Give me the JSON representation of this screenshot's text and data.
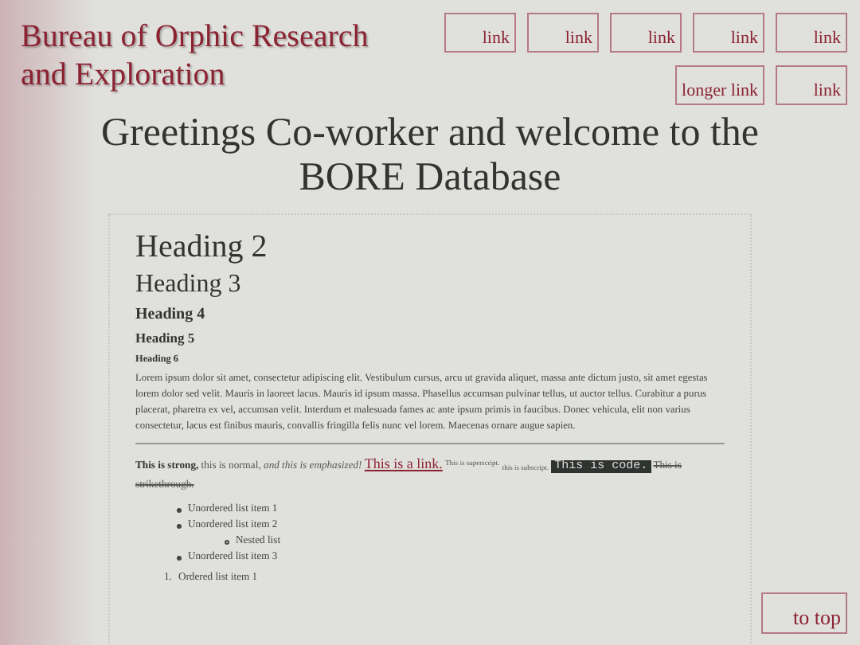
{
  "site_title": "Bureau of Orphic Research and Exploration",
  "nav_links": [
    "link",
    "link",
    "link",
    "link",
    "link",
    "longer link",
    "link"
  ],
  "greeting": "Greetings Co-worker and welcome to the BORE Database",
  "headings": [
    {
      "kind": "h2",
      "text": "Heading 2"
    },
    {
      "kind": "h3",
      "text": "Heading 3"
    },
    {
      "kind": "h4",
      "text": "Heading 4"
    },
    {
      "kind": "h5",
      "text": "Heading 5"
    },
    {
      "kind": "h6",
      "text": "Heading 6"
    }
  ],
  "paragraph": "Lorem ipsum dolor sit amet, consectetur adipiscing elit. Vestibulum cursus, arcu ut gravida aliquet, massa ante dictum justo, sit amet egestas lorem dolor sed velit. Mauris in laoreet lacus. Mauris id ipsum massa. Phasellus accumsan pulvinar tellus, ut auctor tellus. Curabitur a purus placerat, pharetra ex vel, accumsan velit. Interdum et malesuada fames ac ante ipsum primis in faucibus. Donec vehicula, elit non varius consectetur, lacus est finibus mauris, convallis fringilla felis nunc vel lorem. Maecenas ornare augue sapien.",
  "formatting_sample": [
    {
      "kind": "strong",
      "text": "This is strong,"
    },
    {
      "kind": "normal",
      "text": "this is normal,"
    },
    {
      "kind": "em",
      "text": "and this is emphasized!"
    },
    {
      "kind": "link",
      "text": "This is a link."
    },
    {
      "kind": "sup",
      "text": "This is superscript."
    },
    {
      "kind": "sub",
      "text": "this is subscript."
    },
    {
      "kind": "code",
      "text": "This is code."
    },
    {
      "kind": "strike",
      "text": "This is strikethrough."
    }
  ],
  "unordered_list": [
    {
      "text": "Unordered list item 1"
    },
    {
      "text": "Unordered list item 2",
      "children": [
        {
          "text": "Nested list"
        }
      ]
    },
    {
      "text": "Unordered list item 3"
    }
  ],
  "ordered_list": [
    {
      "number": "1.",
      "text": "Ordered list item 1"
    }
  ],
  "to_top": "to top"
}
